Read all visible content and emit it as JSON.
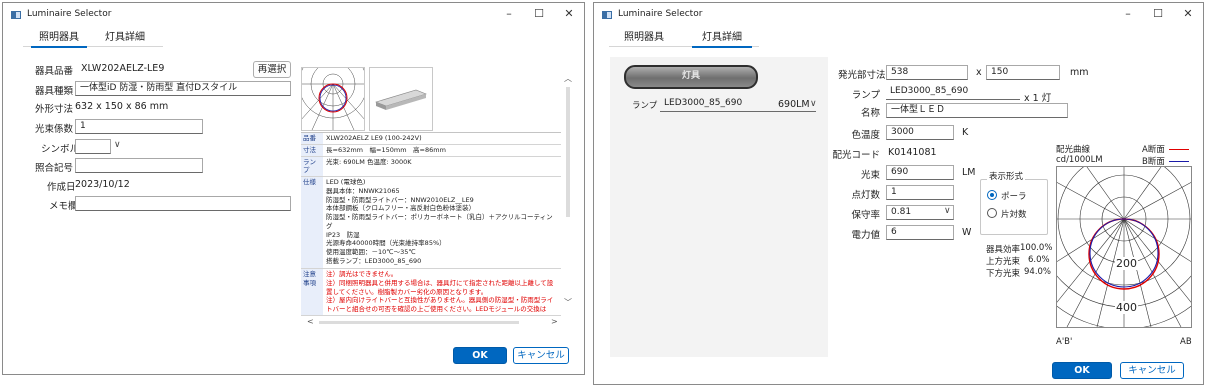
{
  "window1": {
    "title": "Luminaire Selector",
    "controls": {
      "min": "–",
      "max": "☐",
      "close": "✕"
    },
    "tabs": [
      {
        "label": "照明器具",
        "active": true
      },
      {
        "label": "灯具詳細",
        "active": false
      }
    ],
    "form": {
      "product_no_label": "器具品番",
      "product_no_value": "XLW202AELZ-LE9",
      "reselect_button": "再選択",
      "type_label": "器具種類",
      "type_value": "一体型iD 防湿・防雨型 直付Dスタイル",
      "size_label": "外形寸法",
      "size_value": "632 x 150 x 86 mm",
      "coef_label": "光束係数",
      "coef_value": "1",
      "symbol_label": "シンボル",
      "ref_label": "照合記号",
      "ref_value": "",
      "date_label": "作成日",
      "date_value": "2023/10/12",
      "memo_label": "メモ欄",
      "memo_value": ""
    },
    "spec_rows": [
      {
        "key": "品番",
        "value": "XLW202AELZ LE9 (100-242V)"
      },
      {
        "key": "寸法",
        "value": "長=632mm　幅=150mm　高=86mm"
      },
      {
        "key": "ランプ",
        "value": "光束: 690LM 色温度: 3000K"
      },
      {
        "key": "仕様",
        "value": "LED (電球色)\n器具本体：NNWK21065\n防湿型・防雨型ライトバー：NNW2010ELZ__LE9\n本体部鋼板（クロムフリー・高反射白色粉体塗装）\n防湿型・防雨型ライトバー：ポリカーボネート（乳白）＋アクリルコーティング\nIP23　防湿\n光源寿命40000時間（光束維持率85%）\n使用温度範囲：－10℃～35℃\n搭載ランプ：LED3000_85_690"
      },
      {
        "key": "注意事項",
        "value": "注）調光はできません。\n注）同梱照明器具と併用する場合は、器具灯にて指定された距離以上離して設置してください。樹脂製カバー劣化の原因となります。\n注）屋内向けライトバーと互換性がありません。器具側の防湿型・防雨型ライトバーと組合せの可否を確認の上ご使用ください。LEDモジュールの交換は",
        "red": true
      }
    ],
    "ok_button": "OK",
    "cancel_button": "キャンセル"
  },
  "window2": {
    "title": "Luminaire Selector",
    "controls": {
      "min": "–",
      "max": "☐",
      "close": "✕"
    },
    "tabs": [
      {
        "label": "照明器具",
        "active": false
      },
      {
        "label": "灯具詳細",
        "active": true
      }
    ],
    "lamp_button": "灯具",
    "lamp_label": "ランプ",
    "lamp_select_name": "LED3000_85_690",
    "lamp_select_lm": "690LM",
    "fields": {
      "emit_size_label": "発光部寸法",
      "emit_w": "538",
      "emit_x": "x",
      "emit_h": "150",
      "emit_unit": "mm",
      "lamp_label": "ランプ",
      "lamp_value": "LED3000_85_690",
      "lamp_count": "x 1 灯",
      "name_label": "名称",
      "name_value": "一体型ＬＥＤ",
      "color_temp_label": "色温度",
      "color_temp_value": "3000",
      "color_temp_unit": "K",
      "dist_code_label": "配光コード",
      "dist_code_value": "K0141081",
      "flux_label": "光束",
      "flux_value": "690",
      "flux_unit": "LM",
      "count_label": "点灯数",
      "count_value": "1",
      "maint_label": "保守率",
      "maint_value": "0.81",
      "power_label": "電力値",
      "power_value": "6",
      "power_unit": "W"
    },
    "display_group": {
      "title": "表示形式",
      "options": [
        {
          "label": "ポーラ",
          "selected": true
        },
        {
          "label": "片対数",
          "selected": false
        }
      ]
    },
    "curve": {
      "title": "配光曲線",
      "unit": "cd/1000LM",
      "legend_a": "A断面",
      "legend_b": "B断面",
      "color_a": "#e00000",
      "color_b": "#1a1aa8",
      "ring_labels": [
        "200",
        "400"
      ],
      "left_label": "A'B'",
      "right_label": "AB"
    },
    "efficiency": {
      "total_label": "器具効率",
      "total_value": "100.0%",
      "up_label": "上方光束",
      "up_value": "6.0%",
      "down_label": "下方光束",
      "down_value": "94.0%"
    },
    "ok_button": "OK",
    "cancel_button": "キャンセル"
  }
}
